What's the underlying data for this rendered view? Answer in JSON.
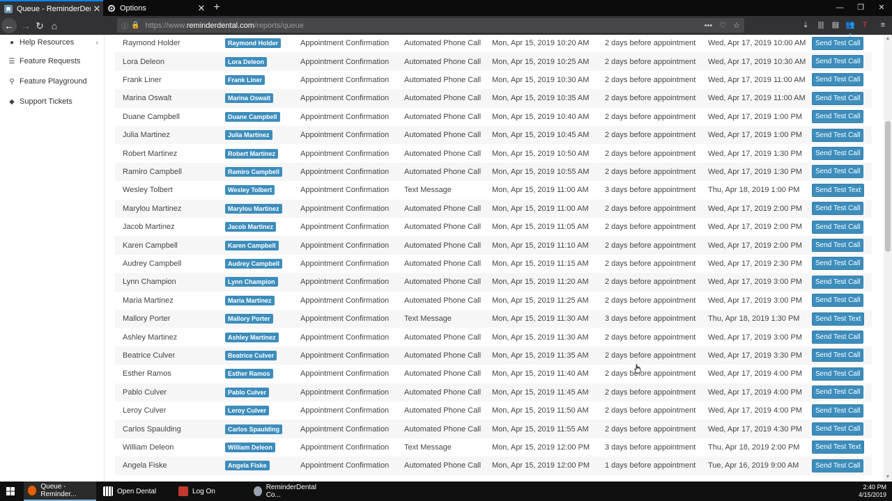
{
  "browser": {
    "tabs": [
      {
        "title": "Queue - ReminderDental",
        "active": true
      },
      {
        "title": "Options",
        "active": false
      }
    ],
    "url_prefix": "https://www.",
    "url_domain": "reminderdental.com",
    "url_path": "/reports/queue",
    "badge_count": "2"
  },
  "sidebar": {
    "items": [
      {
        "label": "Help Resources",
        "icon": "info-circle-icon"
      },
      {
        "label": "Feature Requests",
        "icon": "list-icon"
      },
      {
        "label": "Feature Playground",
        "icon": "pin-icon"
      },
      {
        "label": "Support Tickets",
        "icon": "ticket-icon"
      }
    ]
  },
  "queue": {
    "rows": [
      {
        "name": "Raymond Holder",
        "type": "Appointment Confirmation",
        "method": "Automated Phone Call",
        "created": "Mon, Apr 15, 2019 10:20 AM",
        "timing": "2 days before appointment",
        "scheduled": "Wed, Apr 17, 2019 10:00 AM",
        "action": "Send Test Call"
      },
      {
        "name": "Lora Deleon",
        "type": "Appointment Confirmation",
        "method": "Automated Phone Call",
        "created": "Mon, Apr 15, 2019 10:25 AM",
        "timing": "2 days before appointment",
        "scheduled": "Wed, Apr 17, 2019 10:30 AM",
        "action": "Send Test Call"
      },
      {
        "name": "Frank Liner",
        "type": "Appointment Confirmation",
        "method": "Automated Phone Call",
        "created": "Mon, Apr 15, 2019 10:30 AM",
        "timing": "2 days before appointment",
        "scheduled": "Wed, Apr 17, 2019 11:00 AM",
        "action": "Send Test Call"
      },
      {
        "name": "Marina Oswalt",
        "type": "Appointment Confirmation",
        "method": "Automated Phone Call",
        "created": "Mon, Apr 15, 2019 10:35 AM",
        "timing": "2 days before appointment",
        "scheduled": "Wed, Apr 17, 2019 11:00 AM",
        "action": "Send Test Call"
      },
      {
        "name": "Duane Campbell",
        "type": "Appointment Confirmation",
        "method": "Automated Phone Call",
        "created": "Mon, Apr 15, 2019 10:40 AM",
        "timing": "2 days before appointment",
        "scheduled": "Wed, Apr 17, 2019 1:00 PM",
        "action": "Send Test Call"
      },
      {
        "name": "Julia Martinez",
        "type": "Appointment Confirmation",
        "method": "Automated Phone Call",
        "created": "Mon, Apr 15, 2019 10:45 AM",
        "timing": "2 days before appointment",
        "scheduled": "Wed, Apr 17, 2019 1:00 PM",
        "action": "Send Test Call"
      },
      {
        "name": "Robert Martinez",
        "type": "Appointment Confirmation",
        "method": "Automated Phone Call",
        "created": "Mon, Apr 15, 2019 10:50 AM",
        "timing": "2 days before appointment",
        "scheduled": "Wed, Apr 17, 2019 1:30 PM",
        "action": "Send Test Call"
      },
      {
        "name": "Ramiro Campbell",
        "type": "Appointment Confirmation",
        "method": "Automated Phone Call",
        "created": "Mon, Apr 15, 2019 10:55 AM",
        "timing": "2 days before appointment",
        "scheduled": "Wed, Apr 17, 2019 1:30 PM",
        "action": "Send Test Call"
      },
      {
        "name": "Wesley Tolbert",
        "type": "Appointment Confirmation",
        "method": "Text Message",
        "created": "Mon, Apr 15, 2019 11:00 AM",
        "timing": "3 days before appointment",
        "scheduled": "Thu, Apr 18, 2019 1:00 PM",
        "action": "Send Test Text"
      },
      {
        "name": "Marylou Martinez",
        "type": "Appointment Confirmation",
        "method": "Automated Phone Call",
        "created": "Mon, Apr 15, 2019 11:00 AM",
        "timing": "2 days before appointment",
        "scheduled": "Wed, Apr 17, 2019 2:00 PM",
        "action": "Send Test Call"
      },
      {
        "name": "Jacob Martinez",
        "type": "Appointment Confirmation",
        "method": "Automated Phone Call",
        "created": "Mon, Apr 15, 2019 11:05 AM",
        "timing": "2 days before appointment",
        "scheduled": "Wed, Apr 17, 2019 2:00 PM",
        "action": "Send Test Call"
      },
      {
        "name": "Karen Campbell",
        "type": "Appointment Confirmation",
        "method": "Automated Phone Call",
        "created": "Mon, Apr 15, 2019 11:10 AM",
        "timing": "2 days before appointment",
        "scheduled": "Wed, Apr 17, 2019 2:00 PM",
        "action": "Send Test Call"
      },
      {
        "name": "Audrey Campbell",
        "type": "Appointment Confirmation",
        "method": "Automated Phone Call",
        "created": "Mon, Apr 15, 2019 11:15 AM",
        "timing": "2 days before appointment",
        "scheduled": "Wed, Apr 17, 2019 2:30 PM",
        "action": "Send Test Call"
      },
      {
        "name": "Lynn Champion",
        "type": "Appointment Confirmation",
        "method": "Automated Phone Call",
        "created": "Mon, Apr 15, 2019 11:20 AM",
        "timing": "2 days before appointment",
        "scheduled": "Wed, Apr 17, 2019 3:00 PM",
        "action": "Send Test Call"
      },
      {
        "name": "Maria Martinez",
        "type": "Appointment Confirmation",
        "method": "Automated Phone Call",
        "created": "Mon, Apr 15, 2019 11:25 AM",
        "timing": "2 days before appointment",
        "scheduled": "Wed, Apr 17, 2019 3:00 PM",
        "action": "Send Test Call"
      },
      {
        "name": "Mallory Porter",
        "type": "Appointment Confirmation",
        "method": "Text Message",
        "created": "Mon, Apr 15, 2019 11:30 AM",
        "timing": "3 days before appointment",
        "scheduled": "Thu, Apr 18, 2019 1:30 PM",
        "action": "Send Test Text"
      },
      {
        "name": "Ashley Martinez",
        "type": "Appointment Confirmation",
        "method": "Automated Phone Call",
        "created": "Mon, Apr 15, 2019 11:30 AM",
        "timing": "2 days before appointment",
        "scheduled": "Wed, Apr 17, 2019 3:00 PM",
        "action": "Send Test Call"
      },
      {
        "name": "Beatrice Culver",
        "type": "Appointment Confirmation",
        "method": "Automated Phone Call",
        "created": "Mon, Apr 15, 2019 11:35 AM",
        "timing": "2 days before appointment",
        "scheduled": "Wed, Apr 17, 2019 3:30 PM",
        "action": "Send Test Call"
      },
      {
        "name": "Esther Ramos",
        "type": "Appointment Confirmation",
        "method": "Automated Phone Call",
        "created": "Mon, Apr 15, 2019 11:40 AM",
        "timing": "2 days before appointment",
        "scheduled": "Wed, Apr 17, 2019 4:00 PM",
        "action": "Send Test Call"
      },
      {
        "name": "Pablo Culver",
        "type": "Appointment Confirmation",
        "method": "Automated Phone Call",
        "created": "Mon, Apr 15, 2019 11:45 AM",
        "timing": "2 days before appointment",
        "scheduled": "Wed, Apr 17, 2019 4:00 PM",
        "action": "Send Test Call"
      },
      {
        "name": "Leroy Culver",
        "type": "Appointment Confirmation",
        "method": "Automated Phone Call",
        "created": "Mon, Apr 15, 2019 11:50 AM",
        "timing": "2 days before appointment",
        "scheduled": "Wed, Apr 17, 2019 4:00 PM",
        "action": "Send Test Call"
      },
      {
        "name": "Carlos Spaulding",
        "type": "Appointment Confirmation",
        "method": "Automated Phone Call",
        "created": "Mon, Apr 15, 2019 11:55 AM",
        "timing": "2 days before appointment",
        "scheduled": "Wed, Apr 17, 2019 4:30 PM",
        "action": "Send Test Call"
      },
      {
        "name": "William Deleon",
        "type": "Appointment Confirmation",
        "method": "Text Message",
        "created": "Mon, Apr 15, 2019 12:00 PM",
        "timing": "3 days before appointment",
        "scheduled": "Thu, Apr 18, 2019 2:00 PM",
        "action": "Send Test Text"
      },
      {
        "name": "Angela Fiske",
        "type": "Appointment Confirmation",
        "method": "Automated Phone Call",
        "created": "Mon, Apr 15, 2019 12:00 PM",
        "timing": "1 days before appointment",
        "scheduled": "Tue, Apr 16, 2019 9:00 AM",
        "action": "Send Test Call"
      }
    ]
  },
  "taskbar": {
    "items": [
      {
        "label": "Queue - Reminder...",
        "icon": "firefox-icon",
        "color": "#e66000"
      },
      {
        "label": "Open Dental",
        "icon": "open-dental-icon",
        "color": "#ffffff"
      },
      {
        "label": "Log On",
        "icon": "log-on-icon",
        "color": "#c0392b"
      },
      {
        "label": "ReminderDental Co...",
        "icon": "reminderdental-icon",
        "color": "#9aa4b0"
      }
    ],
    "time": "2:40 PM",
    "date": "4/15/2019"
  },
  "colors": {
    "accent": "#3c8dbc",
    "tab_highlight": "#0a84ff"
  }
}
